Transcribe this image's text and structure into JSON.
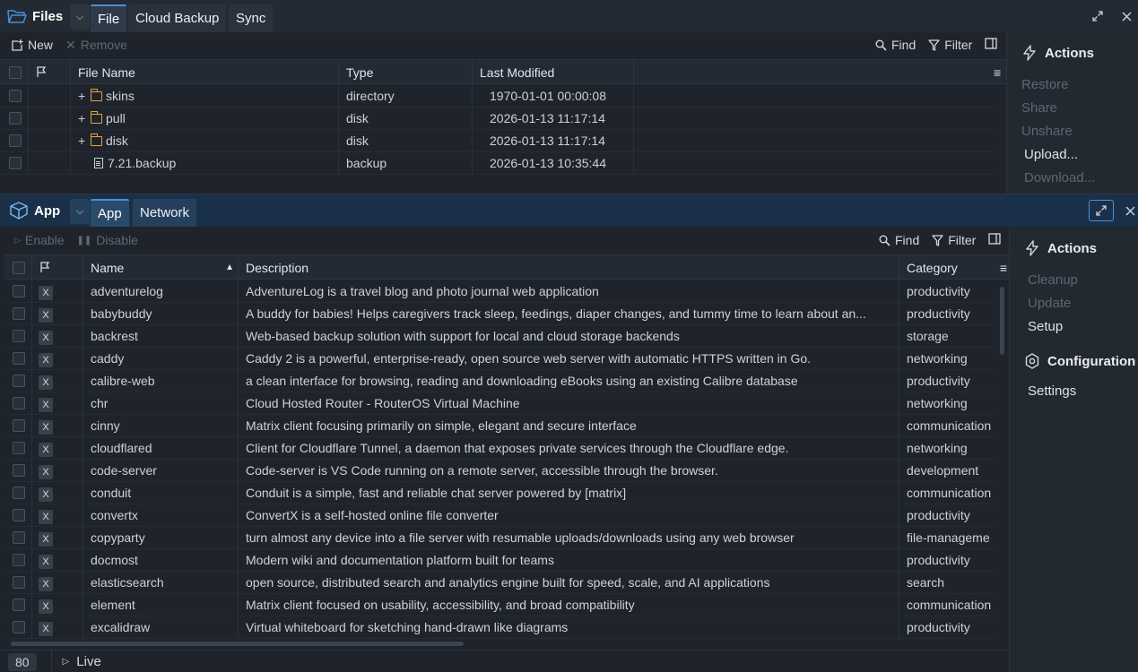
{
  "files_window": {
    "title": "Files",
    "tabs": [
      "File",
      "Cloud Backup",
      "Sync"
    ],
    "toolbar": {
      "new": "New",
      "remove": "Remove",
      "find": "Find",
      "filter": "Filter"
    },
    "columns": {
      "name": "File Name",
      "type": "Type",
      "modified": "Last Modified"
    },
    "rows": [
      {
        "name": "skins",
        "type": "directory",
        "modified": "1970-01-01 00:00:08",
        "kind": "folder"
      },
      {
        "name": "pull",
        "type": "disk",
        "modified": "2026-01-13 11:17:14",
        "kind": "folder"
      },
      {
        "name": "disk",
        "type": "disk",
        "modified": "2026-01-13 11:17:14",
        "kind": "folder"
      },
      {
        "name": "7.21.backup",
        "type": "backup",
        "modified": "2026-01-13 10:35:44",
        "kind": "file"
      }
    ],
    "actions": {
      "header": "Actions",
      "items": [
        {
          "label": "Restore",
          "enabled": false
        },
        {
          "label": "Share",
          "enabled": false
        },
        {
          "label": "Unshare",
          "enabled": false
        },
        {
          "label": "Upload...",
          "enabled": true
        },
        {
          "label": "Download...",
          "enabled": false
        }
      ]
    }
  },
  "app_window": {
    "title": "App",
    "tabs": [
      "App",
      "Network"
    ],
    "toolbar": {
      "enable": "Enable",
      "disable": "Disable",
      "find": "Find",
      "filter": "Filter"
    },
    "columns": {
      "name": "Name",
      "description": "Description",
      "category": "Category"
    },
    "rows": [
      {
        "name": "adventurelog",
        "description": "AdventureLog is a travel blog and photo journal web application",
        "category": "productivity"
      },
      {
        "name": "babybuddy",
        "description": "A buddy for babies! Helps caregivers track sleep, feedings, diaper changes, and tummy time to learn about an...",
        "category": "productivity"
      },
      {
        "name": "backrest",
        "description": "Web-based backup solution with support for local and cloud storage backends",
        "category": "storage"
      },
      {
        "name": "caddy",
        "description": "Caddy 2 is a powerful, enterprise-ready, open source web server with automatic HTTPS written in Go.",
        "category": "networking"
      },
      {
        "name": "calibre-web",
        "description": "a clean interface for browsing, reading and downloading eBooks using an existing Calibre database",
        "category": "productivity"
      },
      {
        "name": "chr",
        "description": "Cloud Hosted Router - RouterOS Virtual Machine",
        "category": "networking"
      },
      {
        "name": "cinny",
        "description": "Matrix client focusing primarily on simple, elegant and secure interface",
        "category": "communication"
      },
      {
        "name": "cloudflared",
        "description": "Client for Cloudflare Tunnel, a daemon that exposes private services through the Cloudflare edge.",
        "category": "networking"
      },
      {
        "name": "code-server",
        "description": "Code-server is VS Code running on a remote server, accessible through the browser.",
        "category": "development"
      },
      {
        "name": "conduit",
        "description": "Conduit is a simple, fast and reliable chat server powered by [matrix]",
        "category": "communication"
      },
      {
        "name": "convertx",
        "description": "ConvertX is a self-hosted online file converter",
        "category": "productivity"
      },
      {
        "name": "copyparty",
        "description": "turn almost any device into a file server with resumable uploads/downloads using any web browser",
        "category": "file-manageme"
      },
      {
        "name": "docmost",
        "description": "Modern wiki and documentation platform built for teams",
        "category": "productivity"
      },
      {
        "name": "elasticsearch",
        "description": "open source, distributed search and analytics engine built for speed, scale, and AI applications",
        "category": "search"
      },
      {
        "name": "element",
        "description": "Matrix client focused on usability, accessibility, and broad compatibility",
        "category": "communication"
      },
      {
        "name": "excalidraw",
        "description": "Virtual whiteboard for sketching hand-drawn like diagrams",
        "category": "productivity"
      }
    ],
    "row_badge": "X",
    "actions": {
      "header": "Actions",
      "items": [
        {
          "label": "Cleanup",
          "enabled": false
        },
        {
          "label": "Update",
          "enabled": false
        },
        {
          "label": "Setup",
          "enabled": true
        }
      ]
    },
    "configuration": {
      "header": "Configuration",
      "items": [
        {
          "label": "Settings",
          "enabled": true
        }
      ]
    },
    "status": {
      "count": "80",
      "live": "Live"
    }
  },
  "colors": {
    "accent": "#4a90d9",
    "folder": "#e3a33b",
    "background": "#1f242c"
  }
}
